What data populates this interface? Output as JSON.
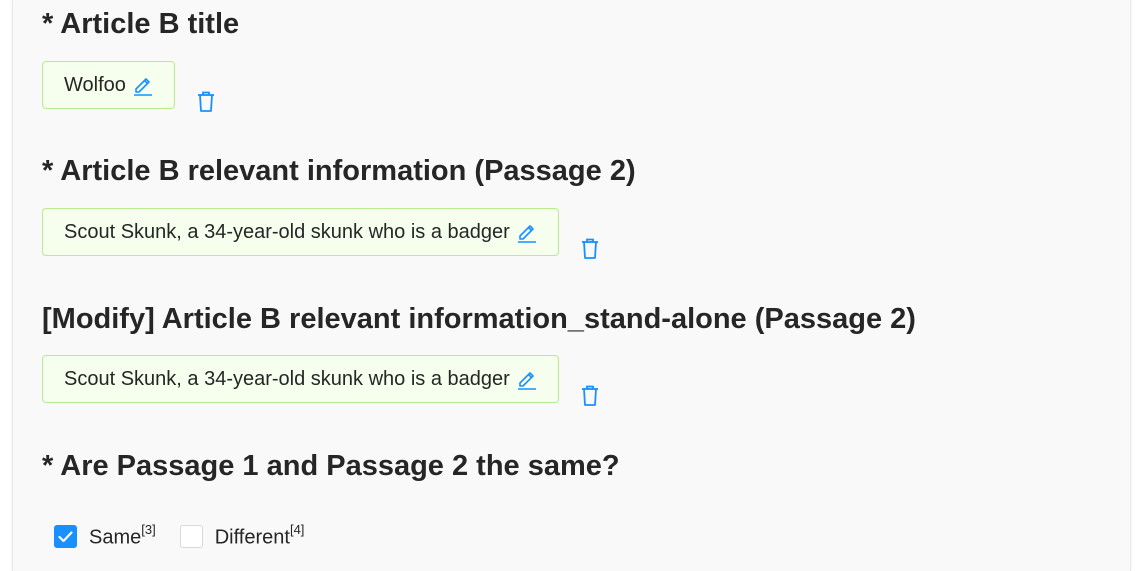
{
  "fields": [
    {
      "heading": "* Article B title",
      "value": "Wolfoo",
      "icons": {
        "edit": "edit-pen-icon",
        "delete": "trash-icon"
      }
    },
    {
      "heading": "* Article B relevant information (Passage 2)",
      "value": "Scout Skunk, a 34-year-old skunk who is a badger",
      "icons": {
        "edit": "edit-pen-icon",
        "delete": "trash-icon"
      }
    },
    {
      "heading": "[Modify] Article B relevant information_stand-alone (Passage 2)",
      "value": "Scout Skunk, a 34-year-old skunk who is a badger",
      "icons": {
        "edit": "edit-pen-icon",
        "delete": "trash-icon"
      }
    }
  ],
  "question": {
    "heading": "* Are Passage 1 and Passage 2 the same?",
    "options": [
      {
        "label": "Same",
        "footnote": "[3]",
        "checked": true
      },
      {
        "label": "Different",
        "footnote": "[4]",
        "checked": false
      }
    ]
  },
  "colors": {
    "accent": "#1890ff",
    "tag_background": "#f6ffed",
    "tag_border": "#b7eb8f",
    "text": "#262626",
    "panel_background": "#f9f9f9"
  }
}
